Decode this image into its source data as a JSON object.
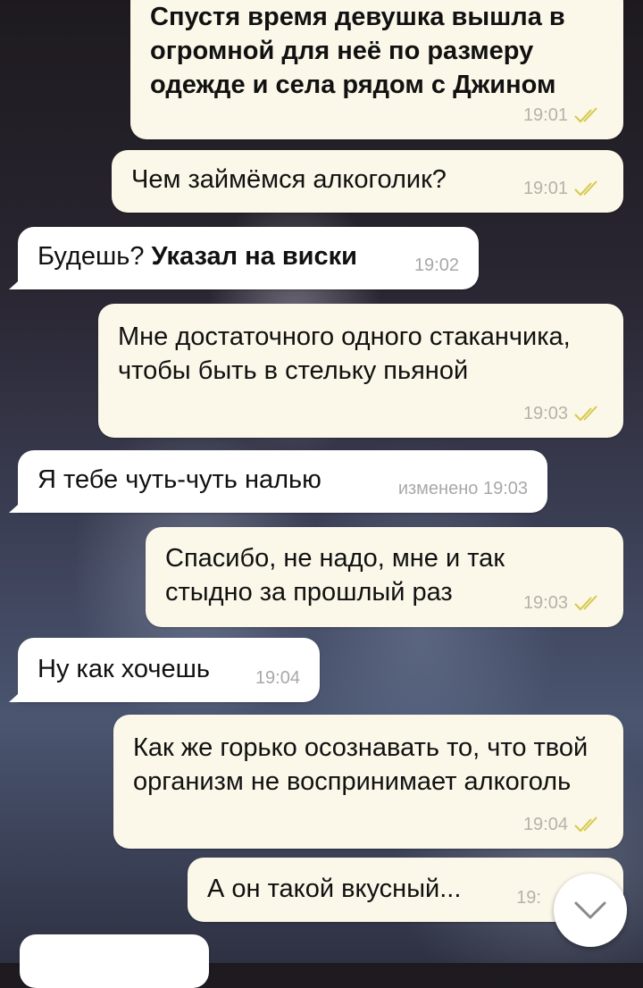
{
  "messages": [
    {
      "side": "out",
      "text": "Спустя время девушка вышла в огромной для неё по размеру одежде и села рядом с Джином",
      "time": "19:01"
    },
    {
      "side": "out",
      "text": "Чем займёмся алкоголик?",
      "time": "19:01"
    },
    {
      "side": "in",
      "text": "Будешь?",
      "bold": "Указал на виски",
      "time": "19:02"
    },
    {
      "side": "out",
      "text": "Мне достаточного одного стаканчика, чтобы быть в стельку пьяной",
      "time": "19:03"
    },
    {
      "side": "in",
      "text": "Я тебе чуть-чуть налью",
      "time": "изменено 19:03"
    },
    {
      "side": "out",
      "text": "Спасибо, не надо, мне и так стыдно за прошлый раз",
      "time": "19:03"
    },
    {
      "side": "in",
      "text": "Ну как хочешь",
      "time": "19:04"
    },
    {
      "side": "out",
      "text": "Как же горько осознавать то, что твой организм не воспринимает алкоголь",
      "time": "19:04"
    },
    {
      "side": "out",
      "text": "А он такой вкусный...",
      "time": "19:"
    },
    {
      "side": "in",
      "text": "",
      "time": ""
    }
  ],
  "icons": {
    "read_check": "double-check-icon",
    "scroll_down": "chevron-down-icon"
  },
  "colors": {
    "outgoing_bubble": "#fbf7e9",
    "incoming_bubble": "#ffffff",
    "check": "#d6c94a"
  }
}
